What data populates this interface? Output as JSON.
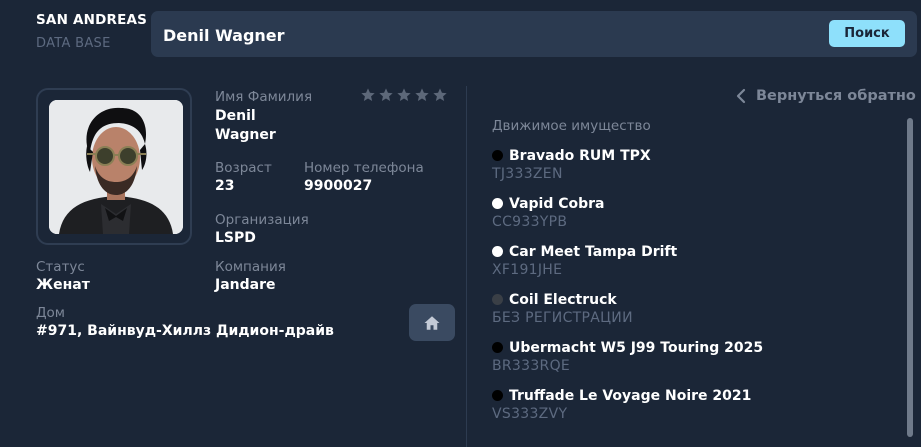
{
  "brand": {
    "line1": "SAN ANDREAS",
    "line2": "DATA BASE"
  },
  "search": {
    "value": "Denil Wagner",
    "button_label": "Поиск"
  },
  "profile": {
    "name_label": "Имя Фамилия",
    "first_name": "Denil",
    "last_name": "Wagner",
    "rating": 0,
    "rating_max": 5,
    "age_label": "Возраст",
    "age": "23",
    "phone_label": "Номер телефона",
    "phone": "9900027",
    "org_label": "Организация",
    "org": "LSPD",
    "status_label": "Статус",
    "status": "Женат",
    "company_label": "Компания",
    "company": "Jandare",
    "home_label": "Дом",
    "home": "#971, Вайнвуд-Хиллз Дидион-драйв"
  },
  "back_label": "Вернуться обратно",
  "assets_title": "Движимое имущество",
  "vehicles": [
    {
      "name": "Bravado RUM TPX",
      "plate": "TJ333ZEN",
      "color": "#000000"
    },
    {
      "name": "Vapid Cobra",
      "plate": "CC933YPB",
      "color": "#ffffff"
    },
    {
      "name": "Car Meet Tampa Drift",
      "plate": "XF191JHE",
      "color": "#ffffff"
    },
    {
      "name": "Coil Electruck",
      "plate": "БЕЗ РЕГИСТРАЦИИ",
      "color": "#3a3f46"
    },
    {
      "name": "Ubermacht W5 J99 Touring 2025",
      "plate": "BR333RQE",
      "color": "#000000"
    },
    {
      "name": "Truffade Le Voyage Noire 2021",
      "plate": "VS333ZVY",
      "color": "#000000"
    }
  ],
  "colors": {
    "background": "#1b2637",
    "accent": "#8ee0fb",
    "muted": "#7d8798"
  },
  "icons": {
    "star": "star-icon",
    "home": "home-icon",
    "back": "chevron-left-icon"
  }
}
